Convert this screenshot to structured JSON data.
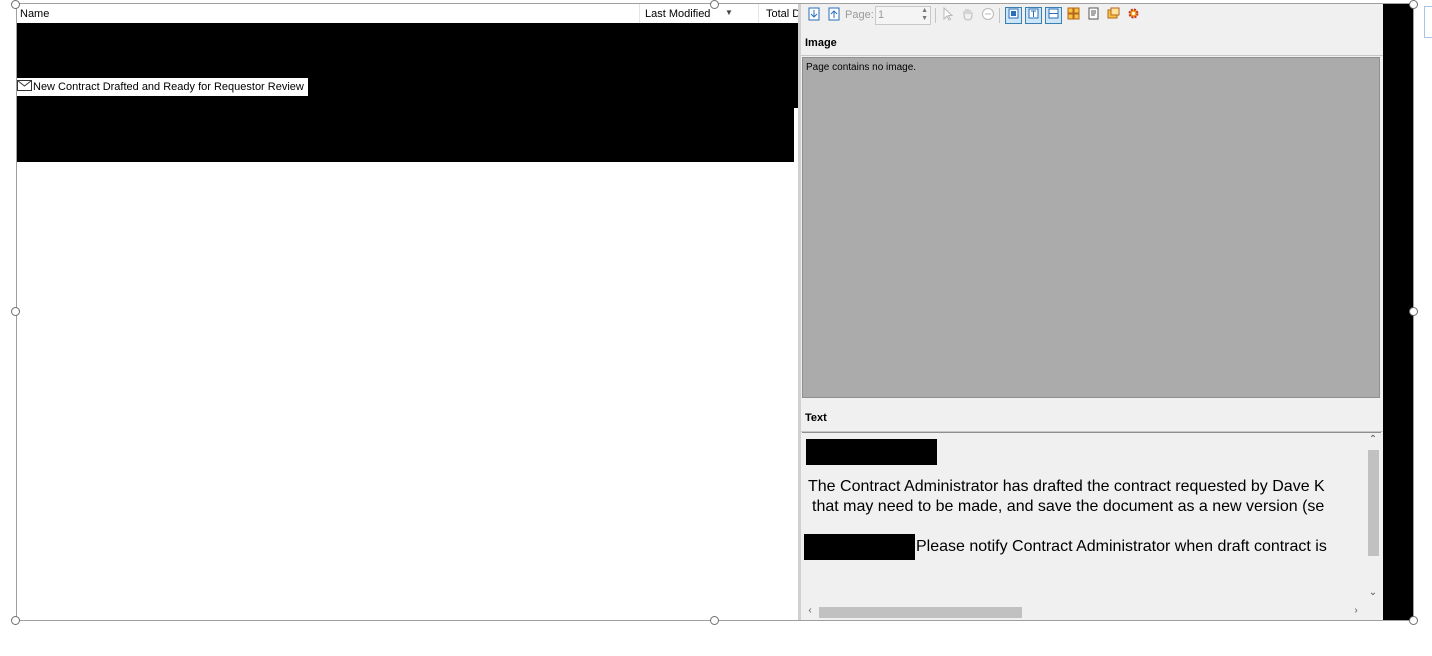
{
  "list": {
    "columns": [
      "Name",
      "Last Modified",
      "Total D"
    ],
    "rows": [
      {
        "name": "New Contract Drafted and Ready for Requestor Review",
        "icon": "envelope-icon"
      }
    ]
  },
  "preview": {
    "toolbar": {
      "page_label": "Page:",
      "page_value": "1"
    },
    "image_section": {
      "title": "Image",
      "message": "Page contains no image."
    },
    "text_section": {
      "title": "Text",
      "lines": [
        "The Contract Administrator has drafted the contract requested by Dave K",
        "that may need to be made, and save the document as a new version (se",
        "Please notify Contract Administrator when draft contract is"
      ]
    }
  },
  "colors": {
    "redaction": "#000000",
    "pane_background": "#f0f0f0",
    "image_area": "#ababab"
  }
}
